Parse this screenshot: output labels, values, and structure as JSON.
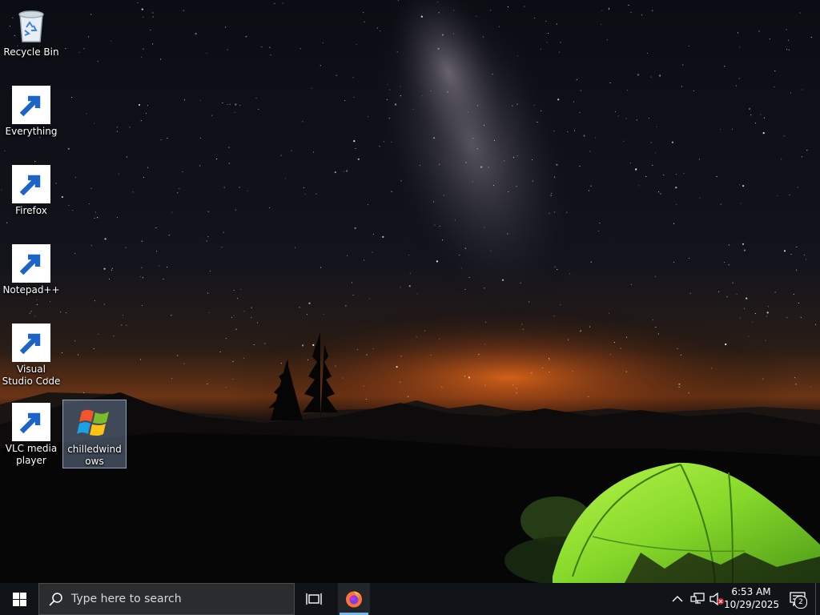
{
  "desktop": {
    "icons": [
      {
        "name": "recycle-bin",
        "label": "Recycle Bin",
        "icon": "recycle-bin-icon",
        "shortcut": false
      },
      {
        "name": "everything",
        "label": "Everything",
        "icon": "magnifier-icon",
        "shortcut": true
      },
      {
        "name": "firefox",
        "label": "Firefox",
        "icon": "firefox-icon",
        "shortcut": true
      },
      {
        "name": "notepad-plus-plus",
        "label": "Notepad++",
        "icon": "notepad-plus-plus-icon",
        "shortcut": true
      },
      {
        "name": "visual-studio-code",
        "label": "Visual Studio Code",
        "icon": "vscode-icon",
        "shortcut": true
      },
      {
        "name": "vlc-media-player",
        "label": "VLC media player",
        "icon": "vlc-cone-icon",
        "shortcut": true
      },
      {
        "name": "chilledwindows",
        "label": "chilledwindows",
        "icon": "windows-xp-logo-icon",
        "shortcut": false,
        "selected": true
      }
    ]
  },
  "taskbar": {
    "search_placeholder": "Type here to search",
    "pinned": [
      {
        "name": "task-view",
        "icon": "task-view-icon"
      },
      {
        "name": "firefox",
        "icon": "firefox-icon",
        "active": true
      }
    ],
    "tray": {
      "icons": [
        "chevron-up-icon",
        "network-icon",
        "volume-muted-icon"
      ],
      "time": "6:53 AM",
      "date": "10/29/2025",
      "notification_count": "2"
    }
  },
  "colors": {
    "taskbar_bg": "#101317",
    "search_bg": "#2b2c2e",
    "accent": "#76b9ed",
    "tent_green": "#8be02a",
    "horizon_glow": "#d8621c"
  }
}
